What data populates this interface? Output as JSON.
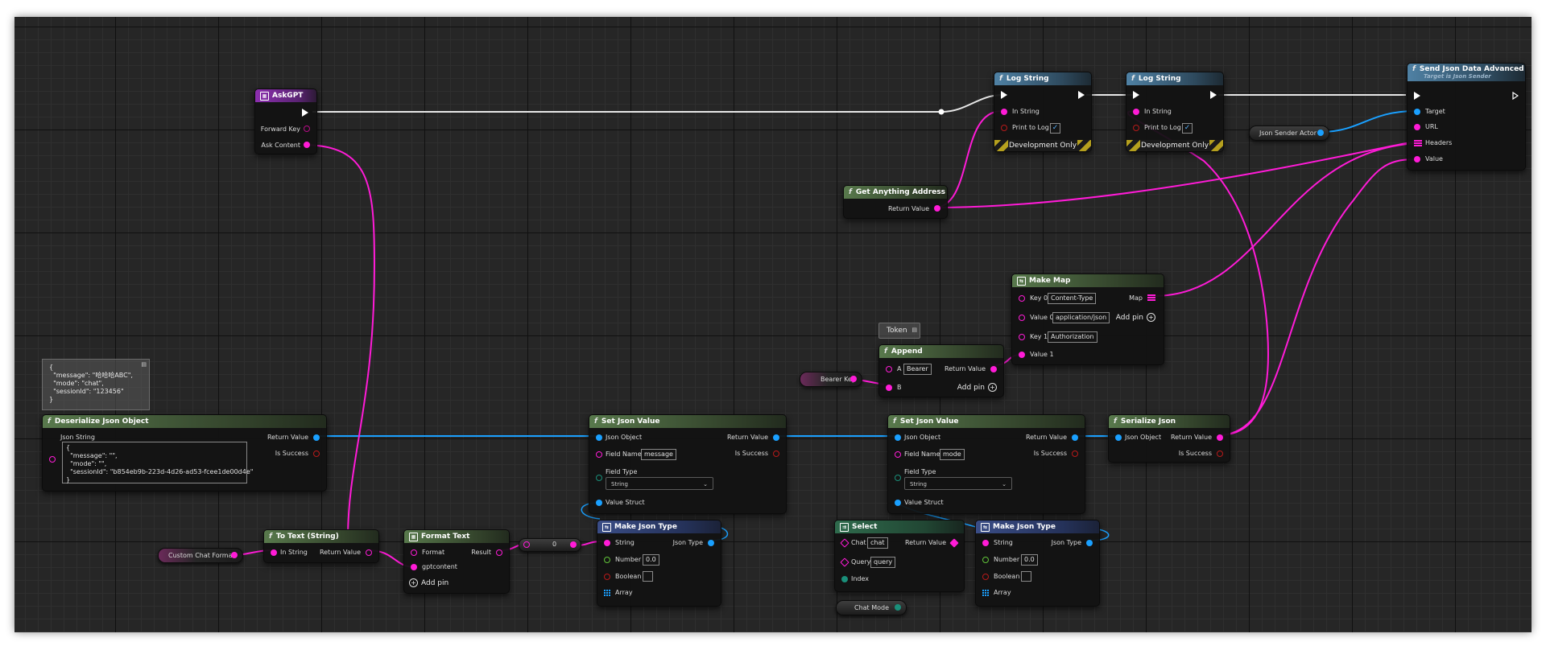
{
  "colors": {
    "exec": "#ffffff",
    "string": "#ff1bd7",
    "object": "#1aa0ff",
    "bool": "#b81a1a",
    "float": "#62c43a",
    "enum": "#1a8f7a",
    "canvas": "#262626"
  },
  "nodes": {
    "askgpt": {
      "title": "AskGPT",
      "forward_key": "Forward Key",
      "ask_content": "Ask Content"
    },
    "log1": {
      "title": "Log String",
      "in_string": "In String",
      "print_to_log": "Print to Log",
      "print_checked": "✓",
      "dev_only": "Development Only"
    },
    "log2": {
      "title": "Log String",
      "in_string": "In String",
      "print_to_log": "Print to Log",
      "print_checked": "✓",
      "dev_only": "Development Only"
    },
    "send": {
      "title": "Send Json Data Advanced",
      "subtitle": "Target is Json Sender",
      "target": "Target",
      "url": "URL",
      "headers": "Headers",
      "value": "Value"
    },
    "json_sender_actor": {
      "label": "Json Sender Actor"
    },
    "get_address": {
      "title": "Get Anything Address",
      "return_value": "Return Value"
    },
    "make_map": {
      "title": "Make Map",
      "key0": "Key 0",
      "key0_val": "Content-Type",
      "value0": "Value 0",
      "value0_val": "application/json",
      "key1": "Key 1",
      "key1_val": "Authorization",
      "value1": "Value 1",
      "map": "Map",
      "add_pin": "Add pin"
    },
    "token_comment": {
      "label": "Token"
    },
    "append": {
      "title": "Append",
      "a": "A",
      "a_val": "Bearer",
      "b": "B",
      "return_value": "Return Value",
      "add_pin": "Add pin"
    },
    "bearer_key": {
      "label": "Bearer Key"
    },
    "comment_json": {
      "text": "{\n  \"message\": \"哈哈哈ABC\",\n  \"mode\": \"chat\",\n  \"sessionId\": \"123456\"\n}"
    },
    "deserialize": {
      "title": "Deserialize Json Object",
      "json_string": "Json String",
      "json_value": "{\n  \"message\": \"\",\n  \"mode\": \"\",\n  \"sessionId\": \"b854eb9b-223d-4d26-ad53-fcee1de00d4e\"\n}",
      "return_value": "Return Value",
      "is_success": "Is Success"
    },
    "set_json1": {
      "title": "Set Json Value",
      "json_object": "Json Object",
      "field_name": "Field Name",
      "field_name_val": "message",
      "field_type": "Field Type",
      "field_type_val": "String",
      "value_struct": "Value Struct",
      "return_value": "Return Value",
      "is_success": "Is Success"
    },
    "set_json2": {
      "title": "Set Json Value",
      "json_object": "Json Object",
      "field_name": "Field Name",
      "field_name_val": "mode",
      "field_type": "Field Type",
      "field_type_val": "String",
      "value_struct": "Value Struct",
      "return_value": "Return Value",
      "is_success": "Is Success"
    },
    "serialize": {
      "title": "Serialize Json",
      "json_object": "Json Object",
      "return_value": "Return Value",
      "is_success": "Is Success"
    },
    "custom_chat": {
      "label": "Custom Chat Format"
    },
    "to_text": {
      "title": "To Text (String)",
      "in_string": "In String",
      "return_value": "Return Value"
    },
    "format_text": {
      "title": "Format Text",
      "format": "Format",
      "gptcontent": "gptcontent",
      "result": "Result",
      "add_pin": "Add pin"
    },
    "reroute": {
      "label": "0"
    },
    "make_json1": {
      "title": "Make Json Type",
      "string": "String",
      "json_type": "Json Type",
      "number": "Number",
      "number_val": "0.0",
      "boolean": "Boolean",
      "array": "Array"
    },
    "select": {
      "title": "Select",
      "chat": "Chat",
      "chat_val": "chat",
      "query": "Query",
      "query_val": "query",
      "index": "Index",
      "return_value": "Return Value"
    },
    "make_json2": {
      "title": "Make Json Type",
      "string": "String",
      "json_type": "Json Type",
      "number": "Number",
      "number_val": "0.0",
      "boolean": "Boolean",
      "array": "Array"
    },
    "chat_mode": {
      "label": "Chat Mode"
    }
  }
}
